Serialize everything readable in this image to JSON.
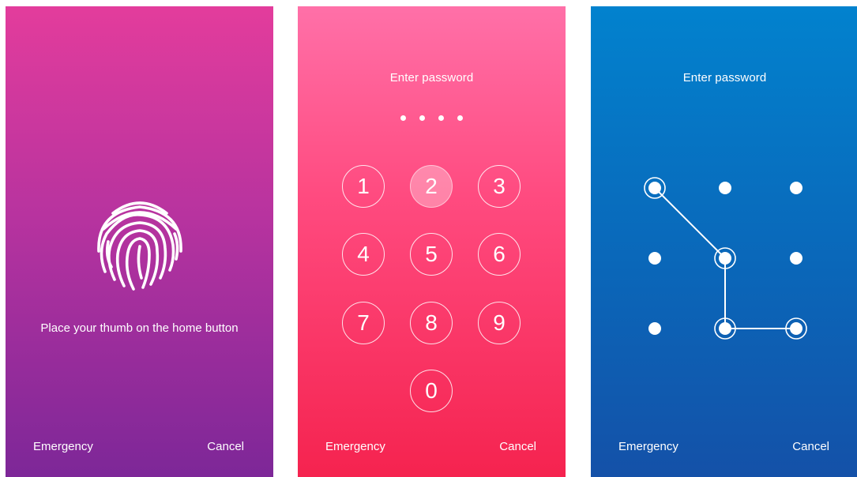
{
  "fingerprint_screen": {
    "instruction": "Place your thumb on the home button",
    "emergency_label": "Emergency",
    "cancel_label": "Cancel"
  },
  "pin_screen": {
    "title": "Enter password",
    "entered_digits_count": 4,
    "keys": [
      "1",
      "2",
      "3",
      "4",
      "5",
      "6",
      "7",
      "8",
      "9",
      "0"
    ],
    "active_key": "2",
    "emergency_label": "Emergency",
    "cancel_label": "Cancel"
  },
  "pattern_screen": {
    "title": "Enter password",
    "grid_size": 3,
    "selected_path": [
      0,
      4,
      7,
      8
    ],
    "emergency_label": "Emergency",
    "cancel_label": "Cancel"
  },
  "icons": {
    "fingerprint": "fingerprint-icon"
  },
  "colors": {
    "fingerprint_bg_top": "#e33c9c",
    "fingerprint_bg_bottom": "#7d2798",
    "pin_bg_top": "#ff70a8",
    "pin_bg_bottom": "#f5234f",
    "pattern_bg_top": "#0282ce",
    "pattern_bg_bottom": "#1451a8",
    "foreground": "#ffffff"
  }
}
